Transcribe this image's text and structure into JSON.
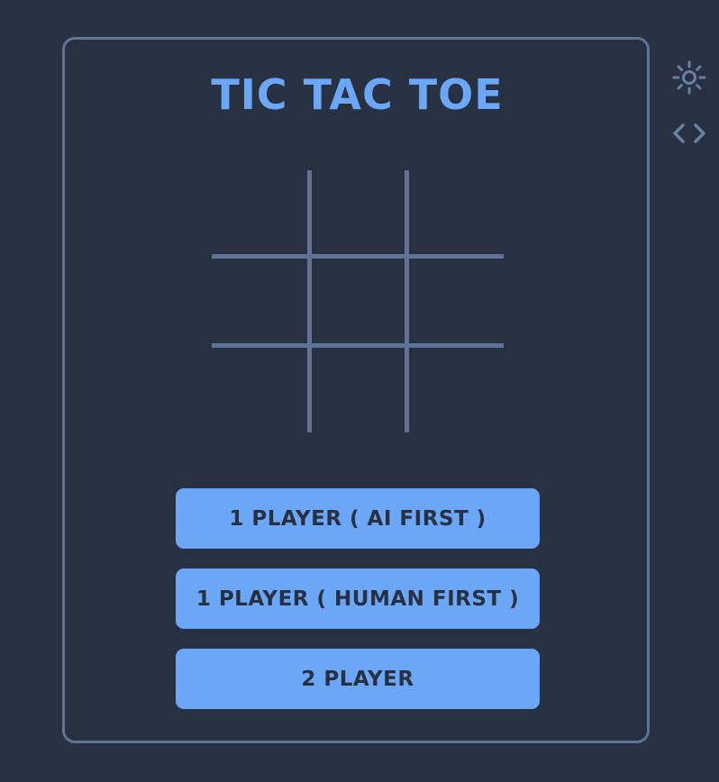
{
  "game": {
    "title": "TIC TAC TOE",
    "board": {
      "rows": 3,
      "cols": 3,
      "cells": [
        "",
        "",
        "",
        "",
        "",
        "",
        "",
        "",
        ""
      ]
    }
  },
  "menu": {
    "buttons": [
      {
        "id": "ai-first",
        "label": "1 PLAYER ( AI FIRST )"
      },
      {
        "id": "human-first",
        "label": "1 PLAYER ( HUMAN FIRST )"
      },
      {
        "id": "two-player",
        "label": "2 PLAYER"
      }
    ]
  },
  "toolbar": {
    "icons": [
      {
        "name": "theme-toggle-icon",
        "glyph": "sun"
      },
      {
        "name": "source-code-icon",
        "glyph": "code"
      }
    ]
  },
  "colors": {
    "background": "#283142",
    "accent": "#6ba6f7",
    "border": "#5f7397",
    "button_text": "#283142"
  }
}
